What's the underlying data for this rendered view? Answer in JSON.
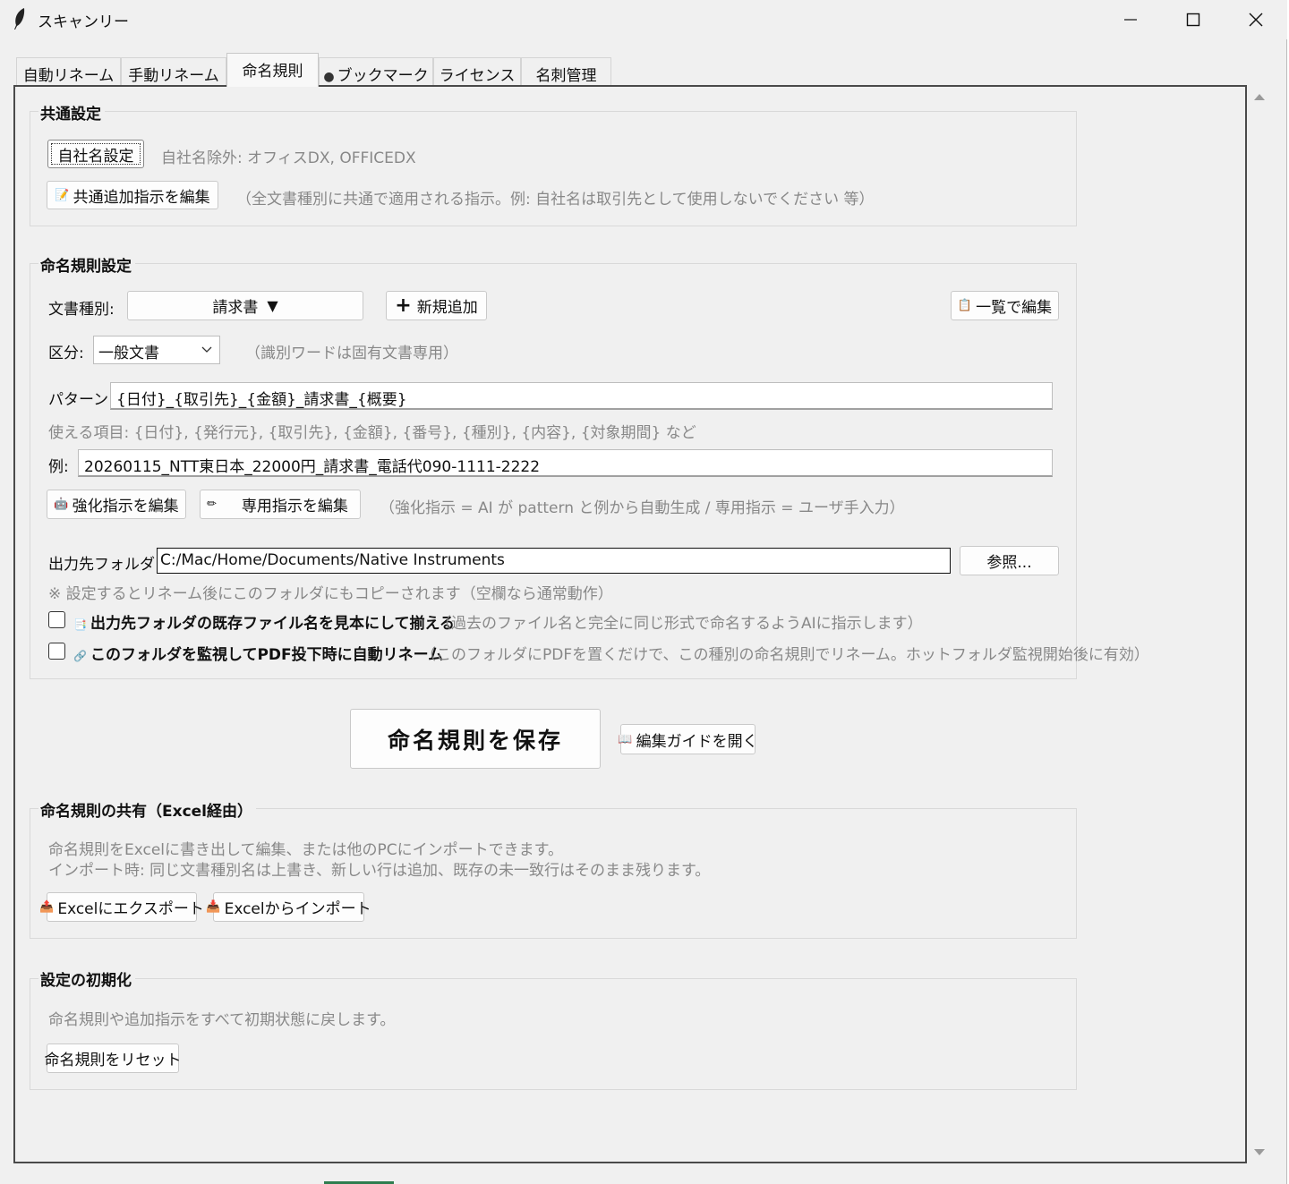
{
  "window": {
    "title": "スキャンリー"
  },
  "tabs": [
    {
      "label": "自動リネーム"
    },
    {
      "label": "手動リネーム"
    },
    {
      "label": "命名規則"
    },
    {
      "label": "ブックマーク",
      "icon": "●"
    },
    {
      "label": "ライセンス"
    },
    {
      "label": "名刺管理"
    }
  ],
  "common": {
    "title": "共通設定",
    "company_button": "自社名設定",
    "company_note": "自社名除外: オフィスDX, OFFICEDX",
    "edit_common_button": "共通追加指示を編集",
    "edit_common_note": "（全文書種別に共通で適用される指示。例: 自社名は取引先として使用しないでください 等）"
  },
  "naming": {
    "title": "命名規則設定",
    "doctype_label": "文書種別:",
    "doctype_value": "請求書",
    "doctype_arrow": "▼",
    "add_button": "新規追加",
    "add_icon": "+",
    "list_edit_button": "一覧で編集",
    "category_label": "区分:",
    "category_value": "一般文書",
    "category_note": "（識別ワードは固有文書専用）",
    "pattern_label": "パターン:",
    "pattern_value": "{日付}_{取引先}_{金額}_請求書_{概要}",
    "items_note": "使える項目: {日付}, {発行元}, {取引先}, {金額}, {番号}, {種別}, {内容}, {対象期間} など",
    "example_label": "例:",
    "example_value": "20260115_NTT東日本_22000円_請求書_電話代090-1111-2222",
    "enhance_button": "強化指示を編集",
    "dedicated_button": "専用指示を編集",
    "instruction_note": "（強化指示 = AI が pattern と例から自動生成 / 専用指示 = ユーザ手入力）",
    "output_label": "出力先フォルダ:",
    "output_value": "C:/Mac/Home/Documents/Native Instruments",
    "browse_button": "参照...",
    "output_note": "※ 設定するとリネーム後にこのフォルダにもコピーされます（空欄なら通常動作）",
    "align_check_label": "出力先フォルダの既存ファイル名を見本にして揃える",
    "align_check_note": "（過去のファイル名と完全に同じ形式で命名するようAIに指示します）",
    "watch_check_label": "このフォルダを監視してPDF投下時に自動リネーム",
    "watch_check_note": "（このフォルダにPDFを置くだけで、この種別の命名規則でリネーム。ホットフォルダ監視開始後に有効）"
  },
  "actions": {
    "save_button": "命名規則を保存",
    "guide_button": "編集ガイドを開く"
  },
  "share": {
    "title": "命名規則の共有（Excel経由）",
    "note1": "命名規則をExcelに書き出して編集、または他のPCにインポートできます。",
    "note2": "インポート時: 同じ文書種別名は上書き、新しい行は追加、既存の未一致行はそのまま残ります。",
    "export_button": "Excelにエクスポート",
    "import_button": "Excelからインポート"
  },
  "reset": {
    "title": "設定の初期化",
    "note": "命名規則や追加指示をすべて初期状態に戻します。",
    "reset_button": "命名規則をリセット"
  }
}
